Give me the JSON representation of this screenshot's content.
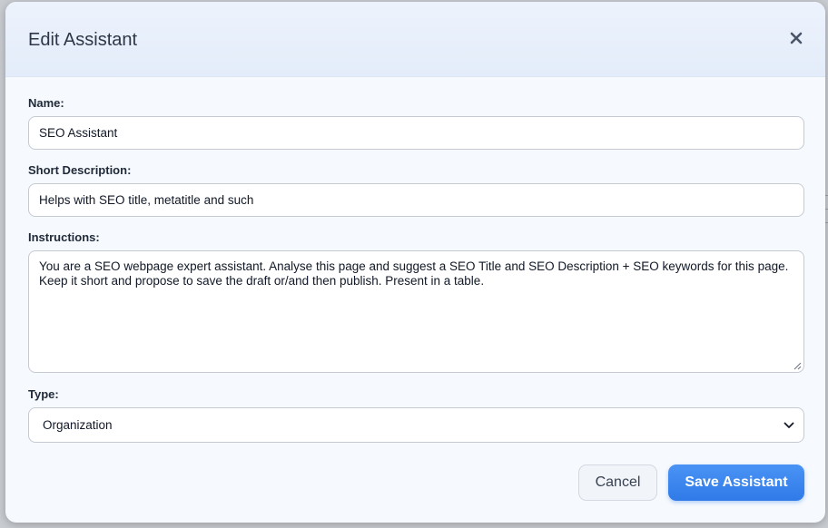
{
  "dialog": {
    "title": "Edit Assistant",
    "close_icon": "close-icon"
  },
  "form": {
    "name": {
      "label": "Name:",
      "value": "SEO Assistant"
    },
    "short_description": {
      "label": "Short Description:",
      "value": "Helps with SEO title, metatitle and such"
    },
    "instructions": {
      "label": "Instructions:",
      "value": "You are a SEO webpage expert assistant. Analyse this page and suggest a SEO Title and SEO Description + SEO keywords for this page. Keep it short and propose to save the draft or/and then publish. Present in a table."
    },
    "type": {
      "label": "Type:",
      "selected": "Organization"
    }
  },
  "actions": {
    "cancel_label": "Cancel",
    "save_label": "Save Assistant"
  },
  "colors": {
    "primary": "#2f7ae8",
    "header_bg": "#e8effb",
    "text": "#1f2937"
  }
}
